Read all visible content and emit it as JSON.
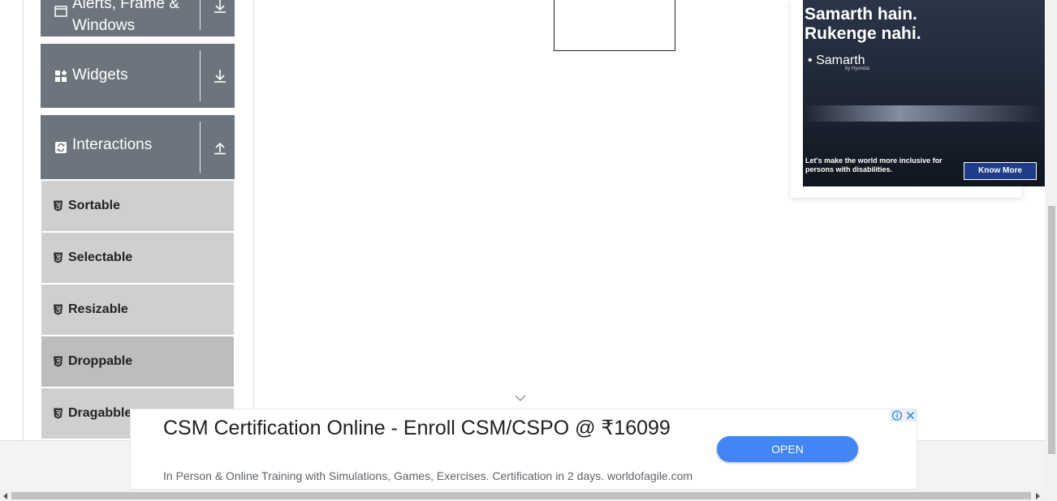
{
  "sidebar": {
    "groups": [
      {
        "label_line1": "Alerts, Frame &",
        "label_line2": "Windows",
        "icon": "window-icon",
        "arrow": "download-arrow-icon"
      },
      {
        "label": "Widgets",
        "icon": "widgets-icon",
        "arrow": "download-arrow-icon"
      },
      {
        "label": "Interactions",
        "icon": "interactions-icon",
        "arrow": "upload-arrow-icon"
      }
    ],
    "items": [
      {
        "label": "Sortable"
      },
      {
        "label": "Selectable"
      },
      {
        "label": "Resizable"
      },
      {
        "label": "Droppable"
      },
      {
        "label": "Dragabble"
      }
    ]
  },
  "side_ad": {
    "headline": "Samarth hain. Rukenge nahi.",
    "brand": "Samarth",
    "brand_sub": "by Hyundai",
    "caption": "Let's make the world more inclusive for persons with disabilities.",
    "cta": "Know More"
  },
  "bottom_ad": {
    "title": "CSM Certification Online - Enroll CSM/CSPO @ ₹16099",
    "description": "In Person & Online Training with Simulations, Games, Exercises. Certification in 2 days. worldofagile.com",
    "open_label": "OPEN"
  },
  "colors": {
    "group_bg": "#6c757d",
    "item_bg": "#cfcfcf",
    "item_active_bg": "#bdbdbd",
    "open_button": "#4285f4"
  }
}
